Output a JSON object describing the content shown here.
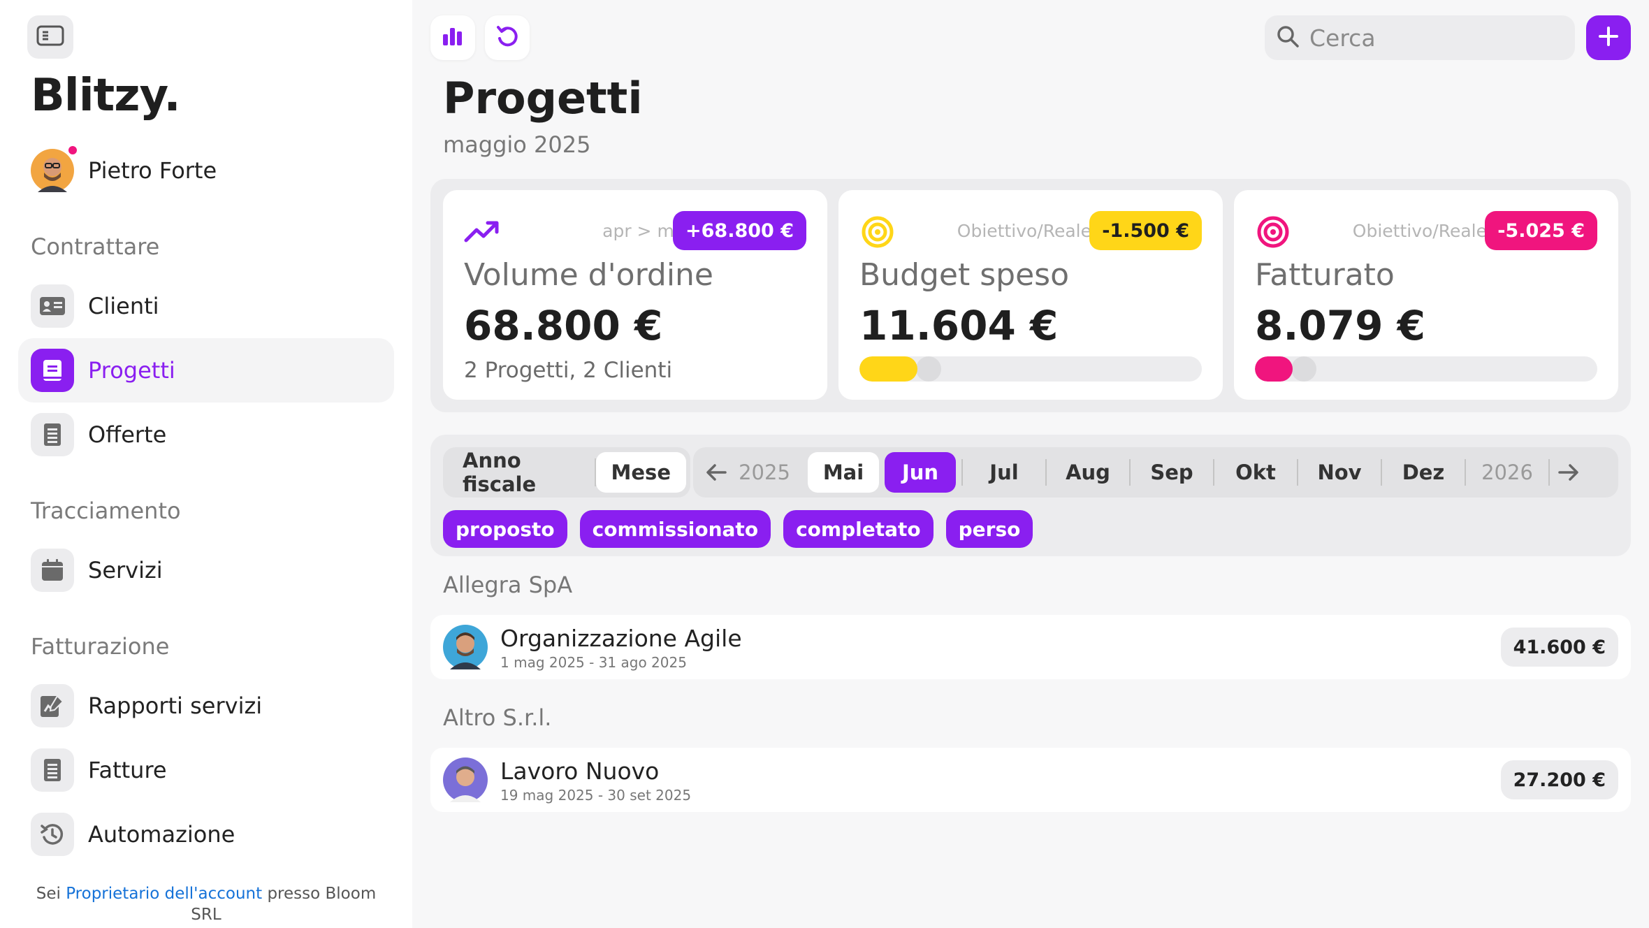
{
  "app": {
    "logo": "Blitzy."
  },
  "user": {
    "name": "Pietro Forte"
  },
  "sidebar": {
    "sections": [
      "Contrattare",
      "Tracciamento",
      "Fatturazione"
    ],
    "items": [
      {
        "label": "Clienti",
        "icon": "contact-card-icon"
      },
      {
        "label": "Progetti",
        "icon": "project-icon",
        "active": true
      },
      {
        "label": "Offerte",
        "icon": "document-icon"
      },
      {
        "label": "Servizi",
        "icon": "calendar-icon"
      },
      {
        "label": "Rapporti servizi",
        "icon": "report-edit-icon"
      },
      {
        "label": "Fatture",
        "icon": "invoice-icon"
      },
      {
        "label": "Automazione",
        "icon": "automation-icon"
      }
    ],
    "footer": {
      "prefix": "Sei",
      "link": "Proprietario dell'account",
      "suffix": "presso Bloom SRL"
    }
  },
  "search": {
    "placeholder": "Cerca"
  },
  "page": {
    "title": "Progetti",
    "subtitle": "maggio 2025"
  },
  "cards": [
    {
      "meta": "apr > mag",
      "badge": "+68.800 €",
      "title": "Volume d'ordine",
      "value": "68.800 €",
      "note": "2 Progetti, 2 Clienti",
      "accent": "#8a1ff0"
    },
    {
      "meta": "Obiettivo/Reale",
      "badge": "-1.500 €",
      "title": "Budget speso",
      "value": "11.604 €",
      "accent": "#ffd618",
      "progress": 0.17
    },
    {
      "meta": "Obiettivo/Reale",
      "badge": "-5.025 €",
      "title": "Fatturato",
      "value": "8.079 €",
      "accent": "#f0157e",
      "progress": 0.11
    }
  ],
  "filters": {
    "period": [
      "Anno fiscale",
      "Mese"
    ],
    "prev_year": "2025",
    "next_year": "2026",
    "months": [
      "Mai",
      "Jun",
      "Jul",
      "Aug",
      "Sep",
      "Okt",
      "Nov",
      "Dez"
    ],
    "statuses": [
      "proposto",
      "commissionato",
      "completato",
      "perso"
    ]
  },
  "groups": [
    {
      "client": "Allegra SpA",
      "projects": [
        {
          "name": "Organizzazione Agile",
          "dates": "1 mag 2025 - 31 ago 2025",
          "amount": "41.600 €"
        }
      ]
    },
    {
      "client": "Altro S.r.l.",
      "projects": [
        {
          "name": "Lavoro Nuovo",
          "dates": "19 mag 2025 - 30 set 2025",
          "amount": "27.200 €"
        }
      ]
    }
  ]
}
